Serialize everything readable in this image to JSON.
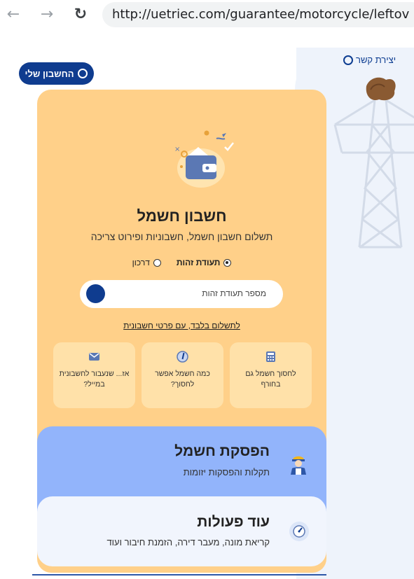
{
  "browser": {
    "url": "http://uetriec.com/guarantee/motorcycle/leftov"
  },
  "header": {
    "contact_label": "יצירת קשר",
    "account_label": "החשבון שלי"
  },
  "bill": {
    "title": "חשבון חשמל",
    "subtitle": "תשלום חשבון חשמל, חשבוניות ופירוט צריכה",
    "radio_options": [
      {
        "label": "תעודת זהות",
        "selected": true
      },
      {
        "label": "דרכון",
        "selected": false
      }
    ],
    "id_placeholder": "מספר תעודת זהות",
    "pay_only_link": "לתשלום בלבד, עם פרטי חשבונית",
    "tiles": [
      {
        "label": "לחסוך חשמל גם בחורף",
        "icon": "calculator-icon"
      },
      {
        "label": "כמה חשמל אפשר לחסוך?",
        "icon": "gauge-icon"
      },
      {
        "label": "אז... שנעבור לחשבונית במייל?",
        "icon": "email-icon"
      }
    ]
  },
  "outage": {
    "title": "הפסקת חשמל",
    "subtitle": "תקלות והפסקות יזומות"
  },
  "more": {
    "title": "עוד פעולות",
    "subtitle": "קריאת מונה, מעבר דירה, הזמנת חיבור ועוד"
  },
  "colors": {
    "primary": "#0f3c8f",
    "card_bg": "#ffd089",
    "tile_bg": "#ffe1a9",
    "outage_bg": "#92b4fb",
    "more_bg": "#f1f5fd",
    "side_bg": "#eef3fb"
  }
}
